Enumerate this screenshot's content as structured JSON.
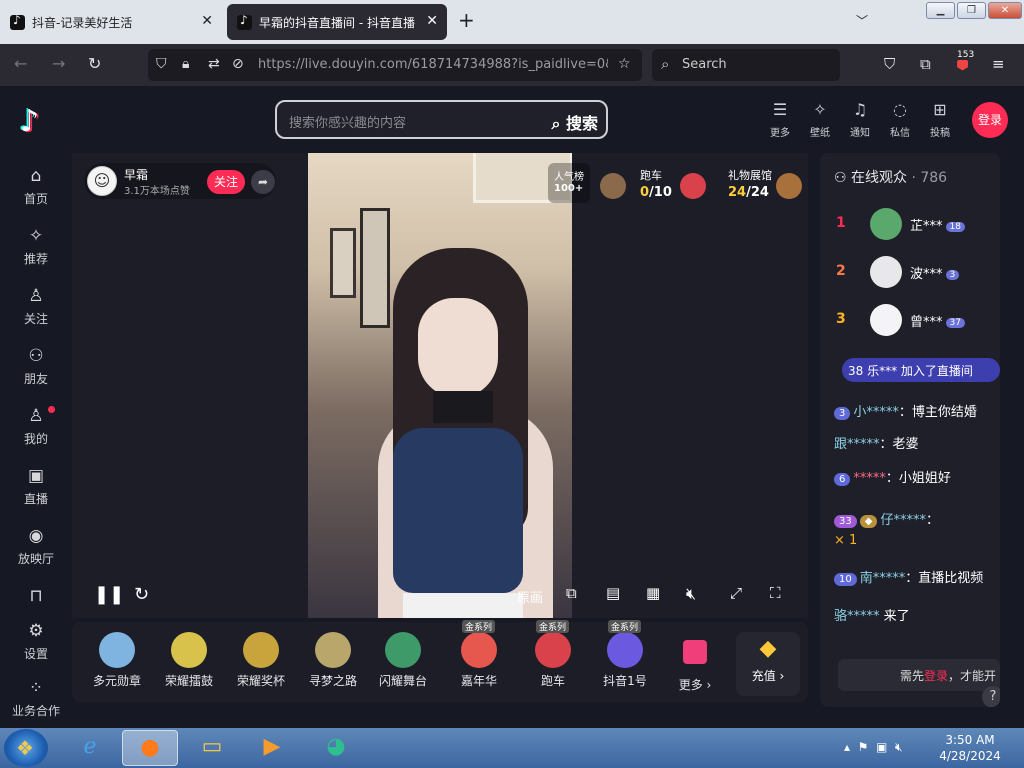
{
  "browser": {
    "tabs": [
      {
        "title": "抖音-记录美好生活"
      },
      {
        "title": "早霜的抖音直播间 - 抖音直播"
      }
    ],
    "url": "https://live.douyin.com/618714734988?is_paidlive=0&w...",
    "search_placeholder": "Search",
    "extension_badge": "153"
  },
  "header": {
    "search_placeholder": "搜索你感兴趣的内容",
    "search_button": "搜索",
    "icons": [
      {
        "label": "更多",
        "icon": "menu-icon"
      },
      {
        "label": "壁纸",
        "icon": "wallpaper-icon"
      },
      {
        "label": "通知",
        "icon": "bell-icon"
      },
      {
        "label": "私信",
        "icon": "message-icon"
      },
      {
        "label": "投稿",
        "icon": "upload-icon"
      }
    ],
    "login": "登录"
  },
  "sidebar": {
    "items": [
      {
        "label": "首页",
        "icon": "home-icon"
      },
      {
        "label": "推荐",
        "icon": "sparkle-icon"
      },
      {
        "label": "关注",
        "icon": "follow-icon"
      },
      {
        "label": "朋友",
        "icon": "friends-icon"
      },
      {
        "label": "我的",
        "icon": "user-icon"
      },
      {
        "label": "直播",
        "icon": "tv-icon"
      },
      {
        "label": "放映厅",
        "icon": "film-icon"
      },
      {
        "label": "",
        "icon": "ticket-icon"
      },
      {
        "label": "设置",
        "icon": "settings-icon"
      },
      {
        "label": "业务合作",
        "icon": "grid-icon"
      }
    ]
  },
  "stream": {
    "streamer_name": "早霜",
    "likes": "3.1万本场点赞",
    "follow": "关注",
    "popularity_label": "人气榜",
    "popularity_value": "100+",
    "race_label": "跑车",
    "race_current": "0",
    "race_total": "/10",
    "gallery_label": "礼物展馆",
    "gallery_current": "24",
    "gallery_total": "/24",
    "quality": "原画"
  },
  "gifts": {
    "items": [
      {
        "label": "多元勋章",
        "tag": "",
        "color": "#7fb3e0"
      },
      {
        "label": "荣耀擂鼓",
        "tag": "",
        "color": "#d8c24c"
      },
      {
        "label": "荣耀奖杯",
        "tag": "",
        "color": "#c9a33c"
      },
      {
        "label": "寻梦之路",
        "tag": "",
        "color": "#b9a66a"
      },
      {
        "label": "闪耀舞台",
        "tag": "",
        "color": "#3f9a6a"
      },
      {
        "label": "嘉年华",
        "tag": "金系列",
        "color": "#e6574e"
      },
      {
        "label": "跑车",
        "tag": "金系列",
        "color": "#d9424a"
      },
      {
        "label": "抖音1号",
        "tag": "金系列",
        "color": "#6b5ae0"
      },
      {
        "label": "更多 ›",
        "tag": "",
        "color": "#ef3e7a"
      }
    ],
    "charge": "充值 ›"
  },
  "audience": {
    "title": "在线观众",
    "count": "· 786",
    "viewers": [
      {
        "rank": "1",
        "name": "芷***",
        "level": "18",
        "rank_color": "#fe2c55",
        "avatar_color": "#5aa86b"
      },
      {
        "rank": "2",
        "name": "波***",
        "level": "3",
        "rank_color": "#ff7a45",
        "avatar_color": "#e8e8ea"
      },
      {
        "rank": "3",
        "name": "曾***",
        "level": "37",
        "rank_color": "#ffb323",
        "avatar_color": "#f4f4f6"
      }
    ],
    "join_message": "38 乐*** 加入了直播间",
    "messages": [
      {
        "level": "3",
        "user": "小*****",
        "text": "：博主你结婚"
      },
      {
        "level": "",
        "user": "跟*****",
        "text": "：老婆"
      },
      {
        "level": "6",
        "user": "*****",
        "text": "：小姐姐好"
      },
      {
        "level": "33",
        "user": "仔*****",
        "text": "："
      },
      {
        "level": "",
        "user": "",
        "text": "× 1"
      },
      {
        "level": "10",
        "user": "南*****",
        "text": "：直播比视频"
      },
      {
        "level": "",
        "user": "骆*****",
        "text": " 来了"
      }
    ],
    "need_login_prefix": "需先",
    "need_login_link": "登录",
    "need_login_suffix": "，才能开"
  },
  "taskbar": {
    "time": "3:50 AM",
    "date": "4/28/2024"
  }
}
